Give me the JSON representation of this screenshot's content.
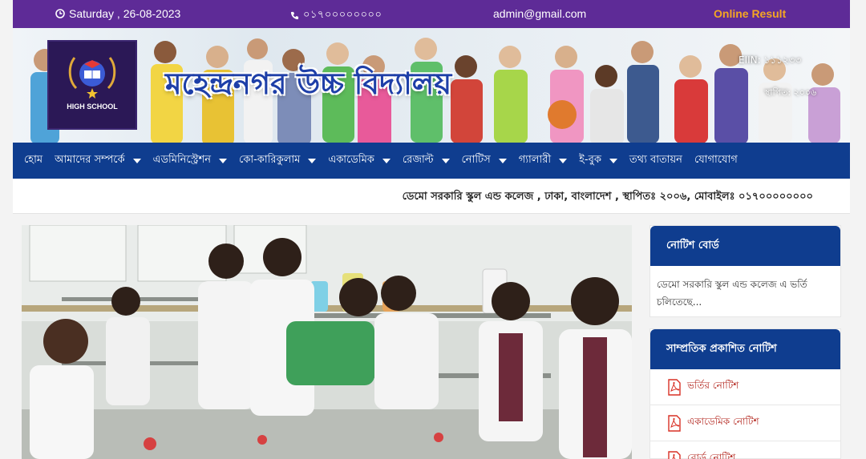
{
  "topbar": {
    "date": "Saturday , 26-08-2023",
    "phone": "০১৭০০০০০০০০",
    "email": "admin@gmail.com",
    "online_result": "Online Result"
  },
  "banner": {
    "school_name": "মহেন্দ্রনগর উচ্চ বিদ্যালয়",
    "logo_text": "HIGH SCHOOL",
    "eiin": "EIIN: ১১১২৩৩",
    "established": "স্থাপিত: ২০০৬"
  },
  "nav": {
    "items": [
      {
        "label": "হোম",
        "dropdown": false
      },
      {
        "label": "আমাদের সম্পর্কে",
        "dropdown": true
      },
      {
        "label": "এডমিনিস্ট্রেশন",
        "dropdown": true
      },
      {
        "label": "কো-কারিকুলাম",
        "dropdown": true
      },
      {
        "label": "একাডেমিক",
        "dropdown": true
      },
      {
        "label": "রেজাল্ট",
        "dropdown": true
      },
      {
        "label": "নোটিস",
        "dropdown": true
      },
      {
        "label": "গ্যালারী",
        "dropdown": true
      },
      {
        "label": "ই-বুক",
        "dropdown": true
      },
      {
        "label": "তথ্য বাতায়ন",
        "dropdown": false
      },
      {
        "label": "যোগাযোগ",
        "dropdown": false
      }
    ]
  },
  "ticker": {
    "text": "ডেমো সরকারি স্কুল এন্ড কলেজ , ঢাকা, বাংলাদেশ , স্থাপিতঃ ২০০৬, মোবাইলঃ ০১৭০০০০০০০০"
  },
  "sidebar": {
    "notice_board": {
      "title": "নোটিশ বোর্ড",
      "text": "ডেমো সরকারি স্কুল এন্ড কলেজ এ ভর্তি চলিতেছে..."
    },
    "recent_notices": {
      "title": "সাম্প্রতিক প্রকাশিত নোটিশ",
      "items": [
        "ভর্তির নোটিশ",
        "একাডেমিক নোটিশ",
        "বোর্ড নোটিশ"
      ]
    }
  },
  "colors": {
    "topbar": "#5e2b97",
    "nav": "#0f3d8f",
    "result_accent": "#f5a623",
    "pdf_red": "#d93025"
  },
  "icons": {
    "date": "clock-icon",
    "phone": "phone-icon",
    "notice": "pdf-icon"
  }
}
